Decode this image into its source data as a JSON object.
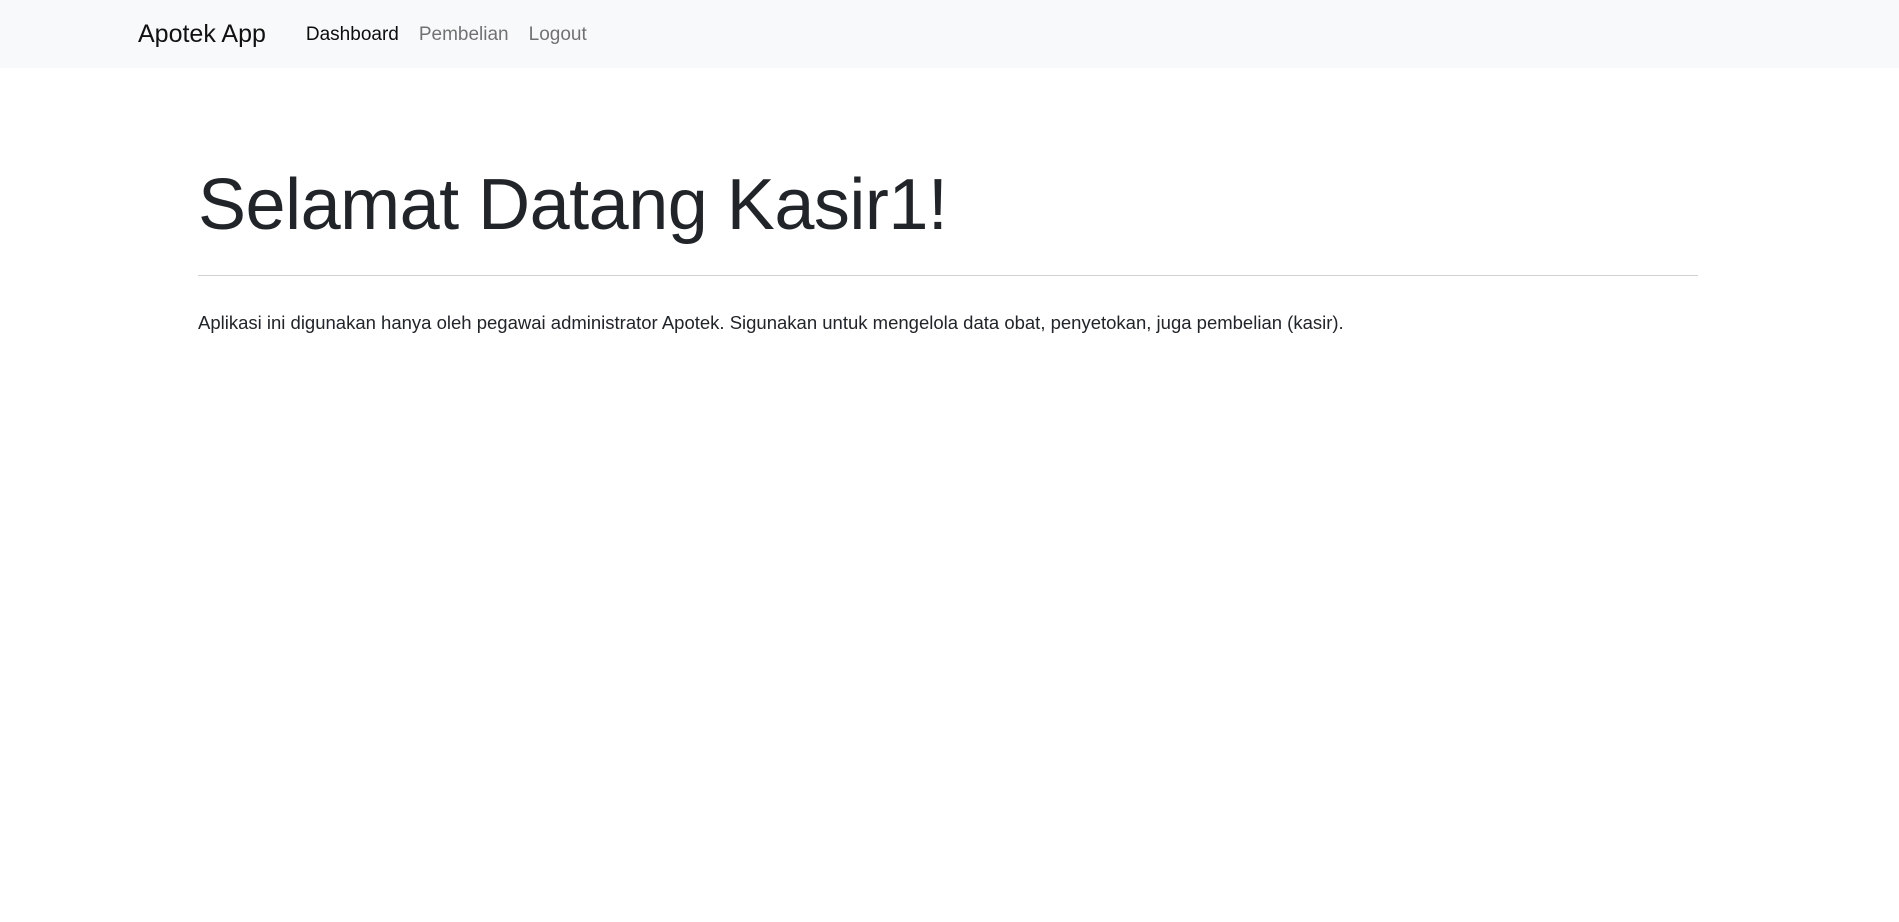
{
  "navbar": {
    "brand": "Apotek App",
    "links": [
      {
        "label": "Dashboard",
        "active": true
      },
      {
        "label": "Pembelian",
        "active": false
      },
      {
        "label": "Logout",
        "active": false
      }
    ]
  },
  "main": {
    "title": "Selamat Datang Kasir1!",
    "description": "Aplikasi ini digunakan hanya oleh pegawai administrator Apotek. Sigunakan untuk mengelola data obat, penyetokan, juga pembelian (kasir)."
  }
}
